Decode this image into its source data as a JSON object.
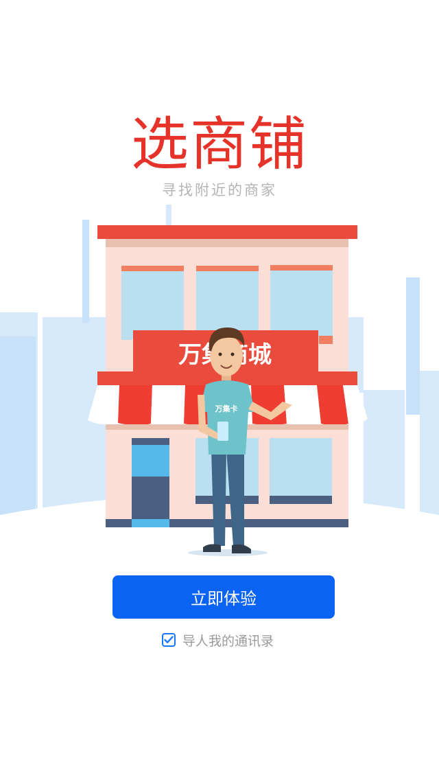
{
  "hero": {
    "title": "选商铺",
    "subtitle": "寻找附近的商家"
  },
  "illustration": {
    "store_sign": "万集商城",
    "shirt_text": "万集卡"
  },
  "actions": {
    "cta_label": "立即体验",
    "import_contacts_label": "导人我的通讯录",
    "import_contacts_checked": true
  },
  "colors": {
    "title_red": "#e5332a",
    "primary_blue": "#0a63f3",
    "sky_blue": "#d6e9fb"
  }
}
